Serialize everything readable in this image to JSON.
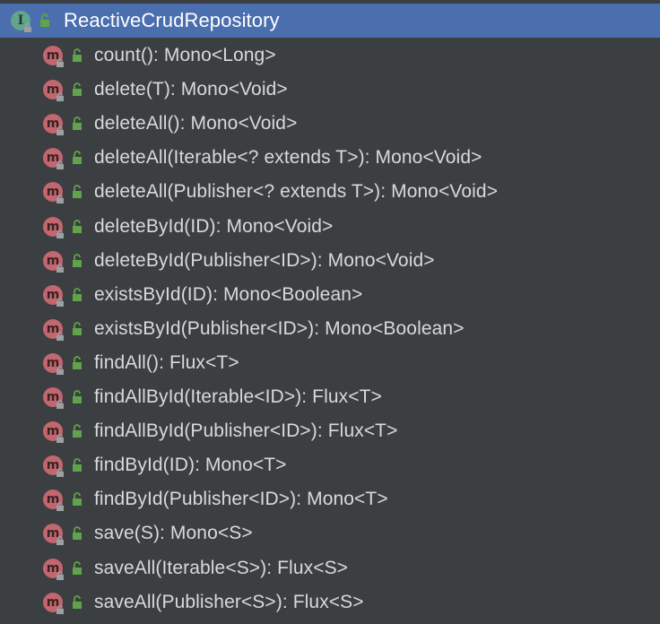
{
  "header": {
    "title": "ReactiveCrudRepository",
    "icon_letter": "I",
    "icon": "interface-icon"
  },
  "method_icon_letter": "m",
  "colors": {
    "selection": "#4b6eaf",
    "background": "#3c3f41",
    "method_icon": "#c2666f",
    "interface_icon": "#62a58e",
    "public_lock": "#5fa34a"
  },
  "methods": [
    {
      "signature": "count(): Mono<Long>"
    },
    {
      "signature": "delete(T): Mono<Void>"
    },
    {
      "signature": "deleteAll(): Mono<Void>"
    },
    {
      "signature": "deleteAll(Iterable<? extends T>): Mono<Void>"
    },
    {
      "signature": "deleteAll(Publisher<? extends T>): Mono<Void>"
    },
    {
      "signature": "deleteById(ID): Mono<Void>"
    },
    {
      "signature": "deleteById(Publisher<ID>): Mono<Void>"
    },
    {
      "signature": "existsById(ID): Mono<Boolean>"
    },
    {
      "signature": "existsById(Publisher<ID>): Mono<Boolean>"
    },
    {
      "signature": "findAll(): Flux<T>"
    },
    {
      "signature": "findAllById(Iterable<ID>): Flux<T>"
    },
    {
      "signature": "findAllById(Publisher<ID>): Flux<T>"
    },
    {
      "signature": "findById(ID): Mono<T>"
    },
    {
      "signature": "findById(Publisher<ID>): Mono<T>"
    },
    {
      "signature": "save(S): Mono<S>"
    },
    {
      "signature": "saveAll(Iterable<S>): Flux<S>"
    },
    {
      "signature": "saveAll(Publisher<S>): Flux<S>"
    }
  ]
}
